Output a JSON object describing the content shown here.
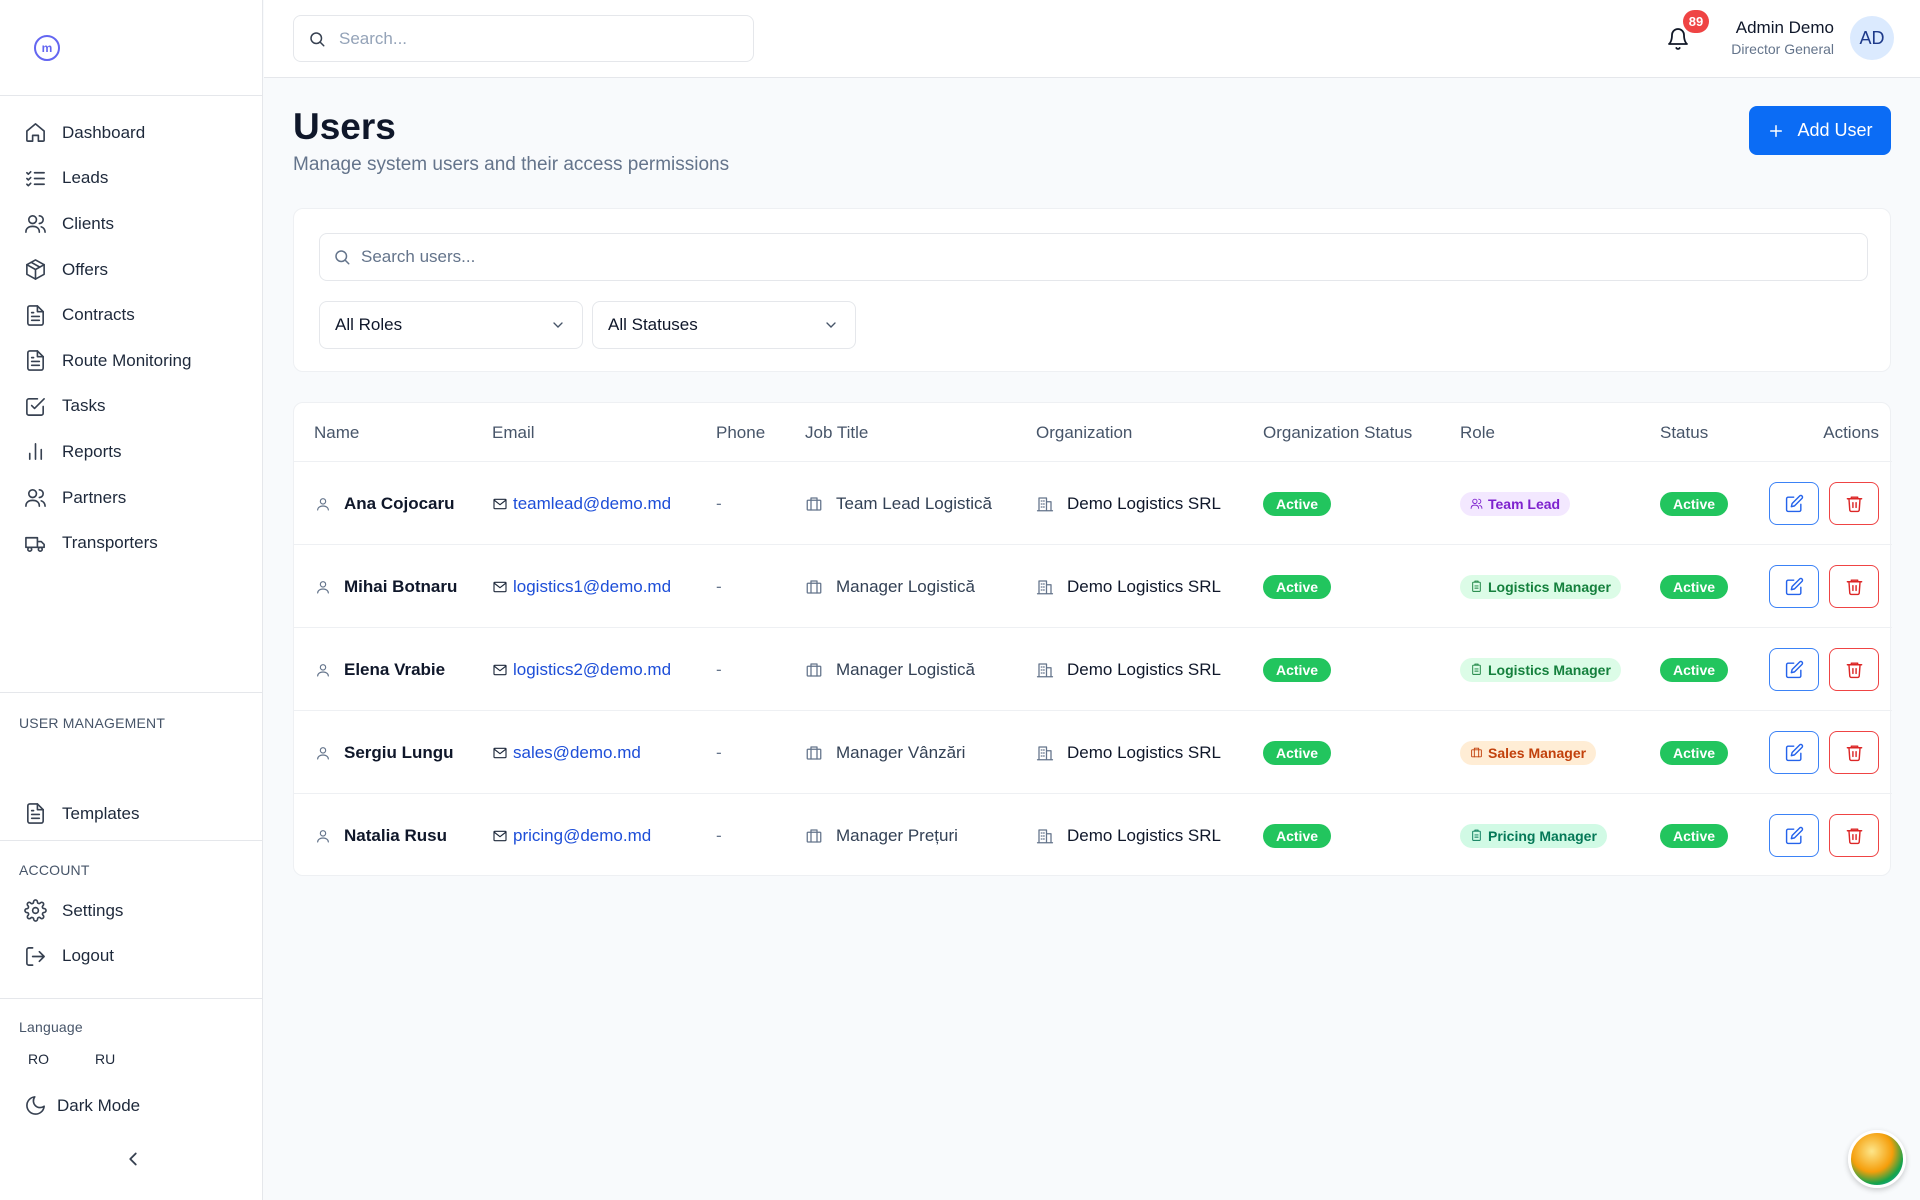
{
  "header": {
    "search_placeholder": "Search...",
    "notifications_count": "89",
    "user_name": "Admin Demo",
    "user_role": "Director General",
    "avatar_initials": "AD"
  },
  "sidebar": {
    "logo_text": "m",
    "nav": [
      {
        "label": "Dashboard",
        "icon": "home-icon"
      },
      {
        "label": "Leads",
        "icon": "list-check-icon"
      },
      {
        "label": "Clients",
        "icon": "users-icon"
      },
      {
        "label": "Offers",
        "icon": "package-icon"
      },
      {
        "label": "Contracts",
        "icon": "file-text-icon"
      },
      {
        "label": "Route Monitoring",
        "icon": "file-text-icon"
      },
      {
        "label": "Tasks",
        "icon": "check-square-icon"
      },
      {
        "label": "Reports",
        "icon": "bar-chart-icon"
      },
      {
        "label": "Partners",
        "icon": "users-icon"
      },
      {
        "label": "Transporters",
        "icon": "truck-icon"
      }
    ],
    "user_management_title": "USER MANAGEMENT",
    "templates_label": "Templates",
    "account_title": "ACCOUNT",
    "settings_label": "Settings",
    "logout_label": "Logout",
    "language_title": "Language",
    "lang_ro": "RO",
    "lang_ru": "RU",
    "dark_mode_label": "Dark Mode"
  },
  "page": {
    "title": "Users",
    "subtitle": "Manage system users and their access permissions",
    "add_button": "Add User"
  },
  "filters": {
    "search_placeholder": "Search users...",
    "roles_value": "All Roles",
    "statuses_value": "All Statuses"
  },
  "table": {
    "columns": [
      "Name",
      "Email",
      "Phone",
      "Job Title",
      "Organization",
      "Organization Status",
      "Role",
      "Status",
      "Actions"
    ],
    "rows": [
      {
        "name": "Ana Cojocaru",
        "email": "teamlead@demo.md",
        "phone": "-",
        "job": "Team Lead Logistică",
        "org": "Demo Logistics SRL",
        "org_status": "Active",
        "role": "Team Lead",
        "role_color": "purple",
        "status": "Active"
      },
      {
        "name": "Mihai Botnaru",
        "email": "logistics1@demo.md",
        "phone": "-",
        "job": "Manager Logistică",
        "org": "Demo Logistics SRL",
        "org_status": "Active",
        "role": "Logistics Manager",
        "role_color": "green",
        "status": "Active"
      },
      {
        "name": "Elena Vrabie",
        "email": "logistics2@demo.md",
        "phone": "-",
        "job": "Manager Logistică",
        "org": "Demo Logistics SRL",
        "org_status": "Active",
        "role": "Logistics Manager",
        "role_color": "green",
        "status": "Active"
      },
      {
        "name": "Sergiu Lungu",
        "email": "sales@demo.md",
        "phone": "-",
        "job": "Manager Vânzări",
        "org": "Demo Logistics SRL",
        "org_status": "Active",
        "role": "Sales Manager",
        "role_color": "orange",
        "status": "Active"
      },
      {
        "name": "Natalia Rusu",
        "email": "pricing@demo.md",
        "phone": "-",
        "job": "Manager Prețuri",
        "org": "Demo Logistics SRL",
        "org_status": "Active",
        "role": "Pricing Manager",
        "role_color": "teal",
        "status": "Active"
      }
    ]
  },
  "colors": {
    "primary": "#0b6cf5",
    "active_green": "#22c55e",
    "danger": "#ef4444"
  }
}
